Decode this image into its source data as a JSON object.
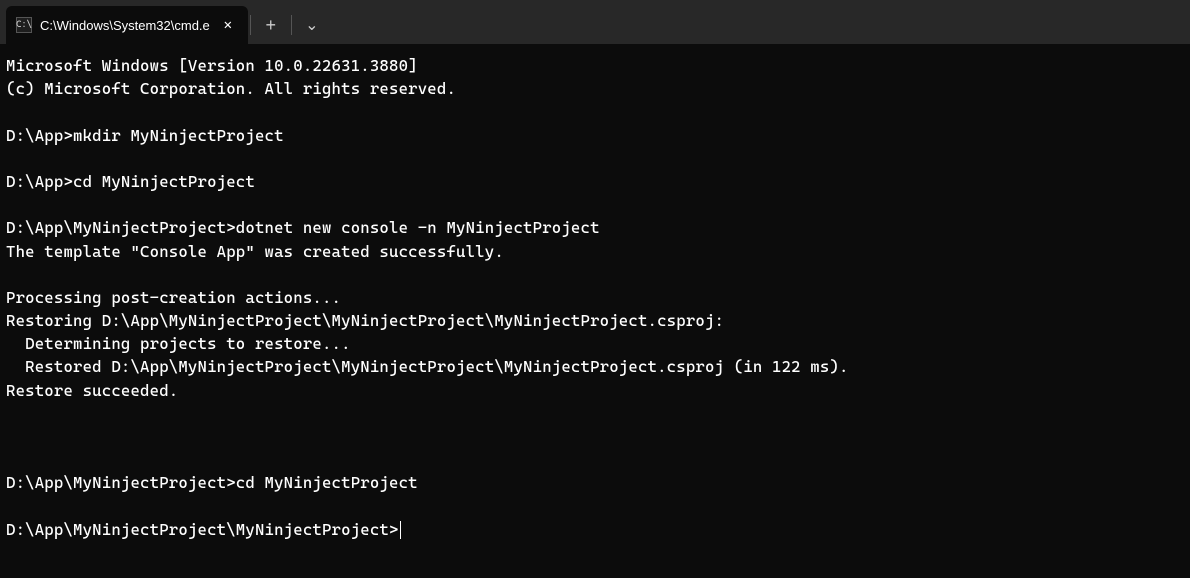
{
  "tab": {
    "title": "C:\\Windows\\System32\\cmd.e",
    "icon_label": "C:\\"
  },
  "titlebar": {
    "new_tab": "+",
    "dropdown": "⌄",
    "close": "✕"
  },
  "lines": [
    "Microsoft Windows [Version 10.0.22631.3880]",
    "(c) Microsoft Corporation. All rights reserved.",
    "",
    "D:\\App>mkdir MyNinjectProject",
    "",
    "D:\\App>cd MyNinjectProject",
    "",
    "D:\\App\\MyNinjectProject>dotnet new console -n MyNinjectProject",
    "The template \"Console App\" was created successfully.",
    "",
    "Processing post-creation actions...",
    "Restoring D:\\App\\MyNinjectProject\\MyNinjectProject\\MyNinjectProject.csproj:",
    "  Determining projects to restore...",
    "  Restored D:\\App\\MyNinjectProject\\MyNinjectProject\\MyNinjectProject.csproj (in 122 ms).",
    "Restore succeeded.",
    "",
    "",
    "",
    "D:\\App\\MyNinjectProject>cd MyNinjectProject",
    "",
    "D:\\App\\MyNinjectProject\\MyNinjectProject>"
  ]
}
